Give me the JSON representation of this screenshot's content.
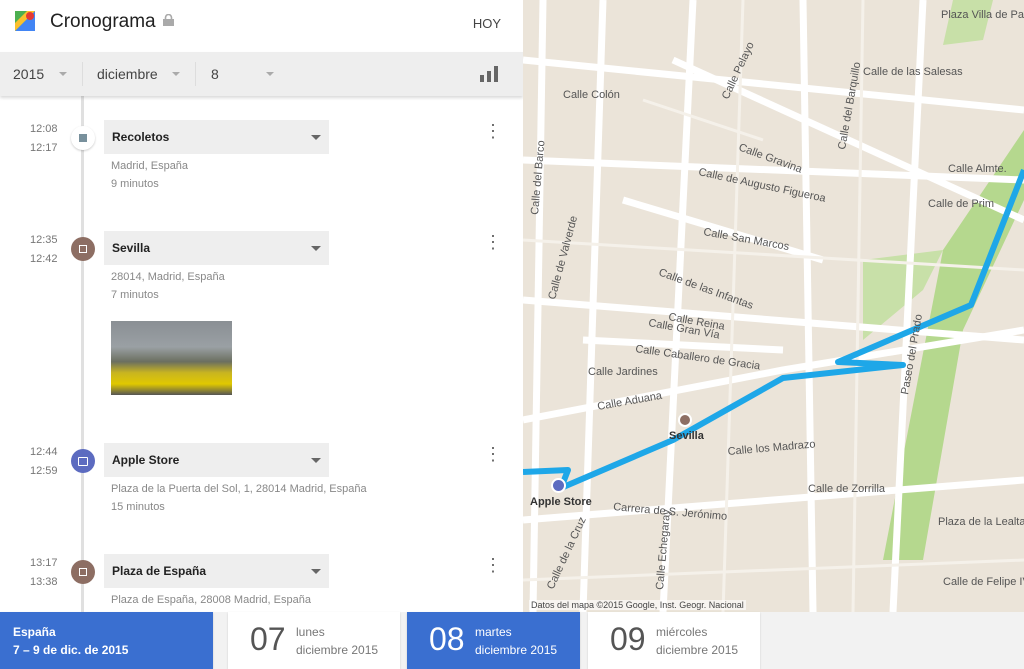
{
  "header": {
    "title": "Cronograma",
    "today": "HOY"
  },
  "filters": {
    "year": "2015",
    "month": "diciembre",
    "day": "8"
  },
  "events": [
    {
      "start": "12:08",
      "end": "12:17",
      "name": "Recoletos",
      "address": "Madrid, España",
      "duration": "9 minutos",
      "icon": "square-icon"
    },
    {
      "start": "12:35",
      "end": "12:42",
      "name": "Sevilla",
      "address": "28014, Madrid, España",
      "duration": "7 minutos",
      "icon": "place-icon"
    },
    {
      "start": "12:44",
      "end": "12:59",
      "name": "Apple Store",
      "address": "Plaza de la Puerta del Sol, 1, 28014 Madrid, España",
      "duration": "15 minutos",
      "icon": "shopping-bag-icon"
    },
    {
      "start": "13:17",
      "end": "13:38",
      "name": "Plaza de España",
      "address": "Plaza de España, 28008 Madrid, España",
      "duration": "",
      "icon": "place-icon"
    }
  ],
  "map": {
    "labels": [
      "Plaza Villa de París",
      "Calle de las Salesas",
      "Calle Colón",
      "Calle Pelayo",
      "Calle del Barquillo",
      "Calle Almte.",
      "Calle de Prim",
      "Calle Gravina",
      "Calle de Augusto Figueroa",
      "Calle del Barco",
      "Calle de Valverde",
      "Calle San Marcos",
      "Calle de las Infantas",
      "Calle Reina",
      "Calle Gran Vía",
      "Calle Caballero de Gracia",
      "Calle Jardines",
      "Calle Aduana",
      "Calle los Madrazo",
      "Calle de Zorrilla",
      "Paseo del Prado",
      "Carrera de S. Jerónimo",
      "Calle de la Cruz",
      "Calle Echegaray",
      "Plaza de la Lealtad",
      "Calle de Felipe IV"
    ],
    "markers": {
      "sevilla": "Sevilla",
      "apple": "Apple Store"
    },
    "attribution": "Datos del mapa ©2015 Google, Inst. Geogr. Nacional",
    "route_color": "#1ea7e8"
  },
  "footer": {
    "region": "España",
    "range": "7 – 9 de dic. de 2015",
    "days": [
      {
        "num": "07",
        "weekday": "lunes",
        "month": "diciembre 2015",
        "selected": false
      },
      {
        "num": "08",
        "weekday": "martes",
        "month": "diciembre 2015",
        "selected": true
      },
      {
        "num": "09",
        "weekday": "miércoles",
        "month": "diciembre 2015",
        "selected": false
      }
    ]
  },
  "colors": {
    "accent": "#3a6fd0",
    "place": "#8d6e63",
    "shop": "#5c6bc0"
  }
}
